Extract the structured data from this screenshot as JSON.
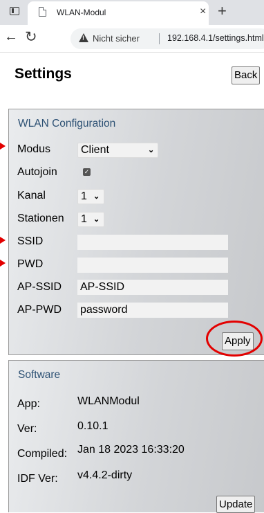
{
  "browser": {
    "tab_title": "WLAN-Modul",
    "tab_close": "×",
    "new_tab": "+",
    "security_label": "Nicht sicher",
    "url": "192.168.4.1/settings.html"
  },
  "page": {
    "title": "Settings",
    "back_label": "Back"
  },
  "wlan": {
    "heading": "WLAN Configuration",
    "modus_label": "Modus",
    "modus_value": "Client",
    "autojoin_label": "Autojoin",
    "autojoin_checked": true,
    "kanal_label": "Kanal",
    "kanal_value": "1",
    "stationen_label": "Stationen",
    "stationen_value": "1",
    "ssid_label": "SSID",
    "ssid_value": "",
    "pwd_label": "PWD",
    "pwd_value": "",
    "ap_ssid_label": "AP-SSID",
    "ap_ssid_value": "AP-SSID",
    "ap_pwd_label": "AP-PWD",
    "ap_pwd_value": "password",
    "apply_label": "Apply"
  },
  "software": {
    "heading": "Software",
    "app_label": "App:",
    "app_value": "WLANModul",
    "ver_label": "Ver:",
    "ver_value": "0.10.1",
    "compiled_label": "Compiled:",
    "compiled_value": "Jan 18 2023 16:33:20",
    "idf_label": "IDF Ver:",
    "idf_value": "v4.4.2-dirty",
    "update_label": "Update"
  },
  "icons": {
    "tab_list": "tab-list-icon",
    "page": "page-icon",
    "back": "back-arrow-icon",
    "reload": "reload-icon",
    "warning": "warning-icon",
    "chevron": "chevron-down-icon",
    "check": "check-icon"
  },
  "annotation": {
    "arrow_color": "#e30000",
    "circle_color": "#e30000"
  },
  "colors": {
    "heading_text": "#2d5174",
    "panel_bg": "#d3d5d8",
    "tabbar_bg": "#dfe1e5"
  }
}
